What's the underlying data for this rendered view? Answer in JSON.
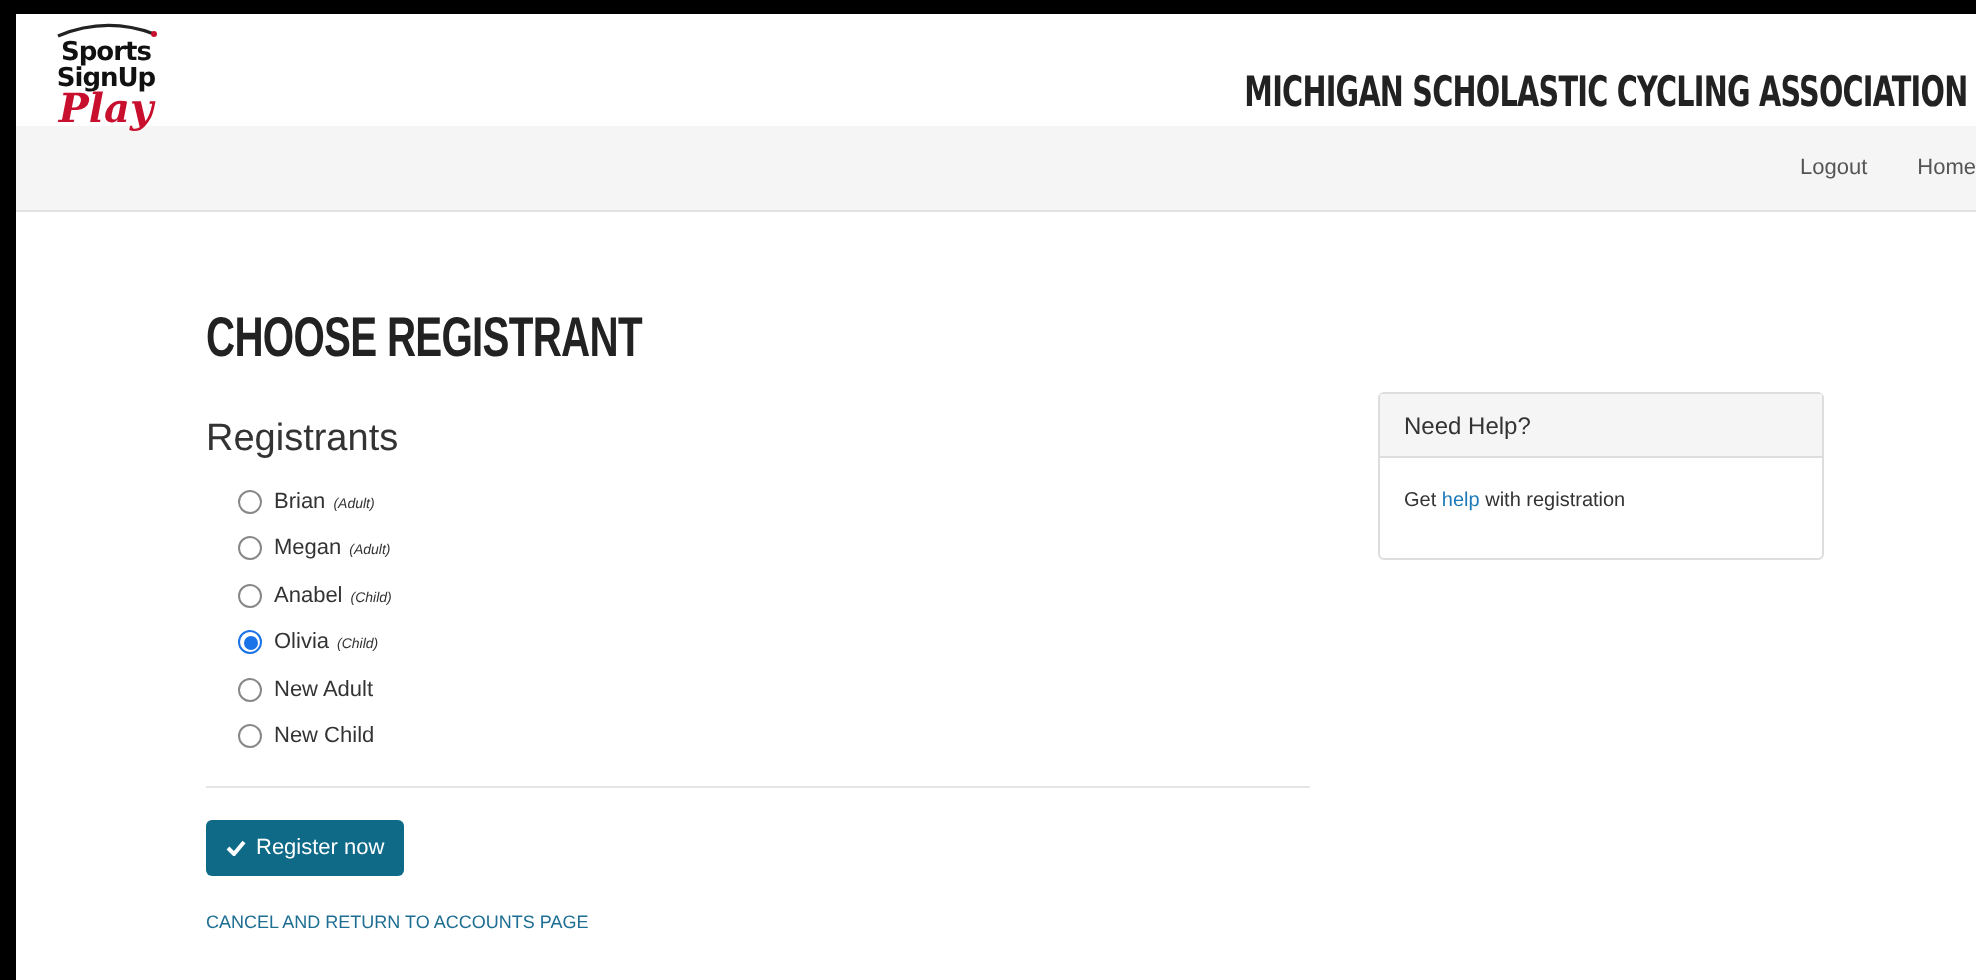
{
  "logo": {
    "line_1": "Sports",
    "line_2": "SignUp",
    "line_3": "Play"
  },
  "header": {
    "title": "MICHIGAN SCHOLASTIC CYCLING ASSOCIATION"
  },
  "nav": [
    {
      "label": "Logout"
    },
    {
      "label": "Home"
    }
  ],
  "page_title": "CHOOSE REGISTRANT",
  "registrants": {
    "heading": "Registrants",
    "options": [
      {
        "name": "Brian",
        "note": "(Adult)",
        "selected": false
      },
      {
        "name": "Megan",
        "note": "(Adult)",
        "selected": false
      },
      {
        "name": "Anabel",
        "note": "(Child)",
        "selected": false
      },
      {
        "name": "Olivia",
        "note": "(Child)",
        "selected": true
      },
      {
        "name": "New Adult",
        "selected": false
      },
      {
        "name": "New Child",
        "selected": false
      }
    ]
  },
  "register_button": "Register now",
  "cancel_link": "CANCEL AND RETURN TO ACCOUNTS PAGE",
  "help_panel": {
    "title": "Need Help?",
    "text_before": "Get",
    "link": "help",
    "text_after": "with registration"
  }
}
